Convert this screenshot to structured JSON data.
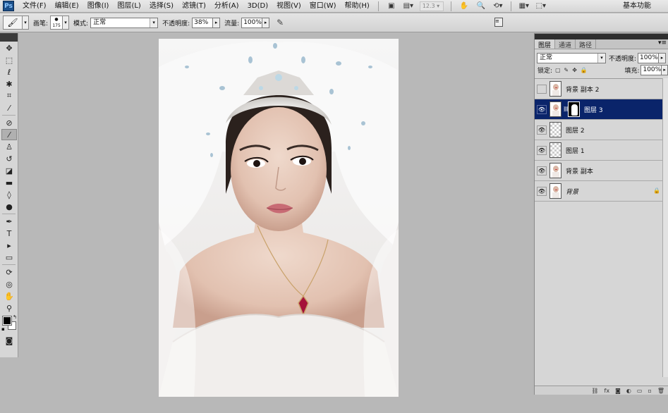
{
  "app": {
    "logo": "Ps"
  },
  "menu": {
    "items": [
      "文件(F)",
      "编辑(E)",
      "图像(I)",
      "图层(L)",
      "选择(S)",
      "滤镜(T)",
      "分析(A)",
      "3D(D)",
      "视图(V)",
      "窗口(W)",
      "帮助(H)"
    ],
    "zoom": "12.3",
    "workspace": "基本功能"
  },
  "options": {
    "brush_label": "画笔:",
    "brush_size": "175",
    "mode_label": "模式:",
    "mode_value": "正常",
    "opacity_label": "不透明度:",
    "opacity_value": "38%",
    "flow_label": "流量:",
    "flow_value": "100%"
  },
  "layers_panel": {
    "tabs": [
      "图层",
      "通道",
      "路径"
    ],
    "blend_mode": "正常",
    "opacity_label": "不透明度:",
    "opacity_value": "100%",
    "lock_label": "锁定:",
    "fill_label": "填充:",
    "fill_value": "100%",
    "layers": [
      {
        "name": "背景 副本 2",
        "visible": false,
        "thumb": "photo"
      },
      {
        "name": "图层 3",
        "visible": true,
        "thumb": "photo",
        "mask": true,
        "selected": true
      },
      {
        "name": "图层 2",
        "visible": true,
        "thumb": "transparent"
      },
      {
        "name": "图层 1",
        "visible": true,
        "thumb": "transparent"
      },
      {
        "name": "背景 副本",
        "visible": true,
        "thumb": "photo"
      },
      {
        "name": "背景",
        "visible": true,
        "thumb": "photo",
        "locked": true
      }
    ]
  }
}
